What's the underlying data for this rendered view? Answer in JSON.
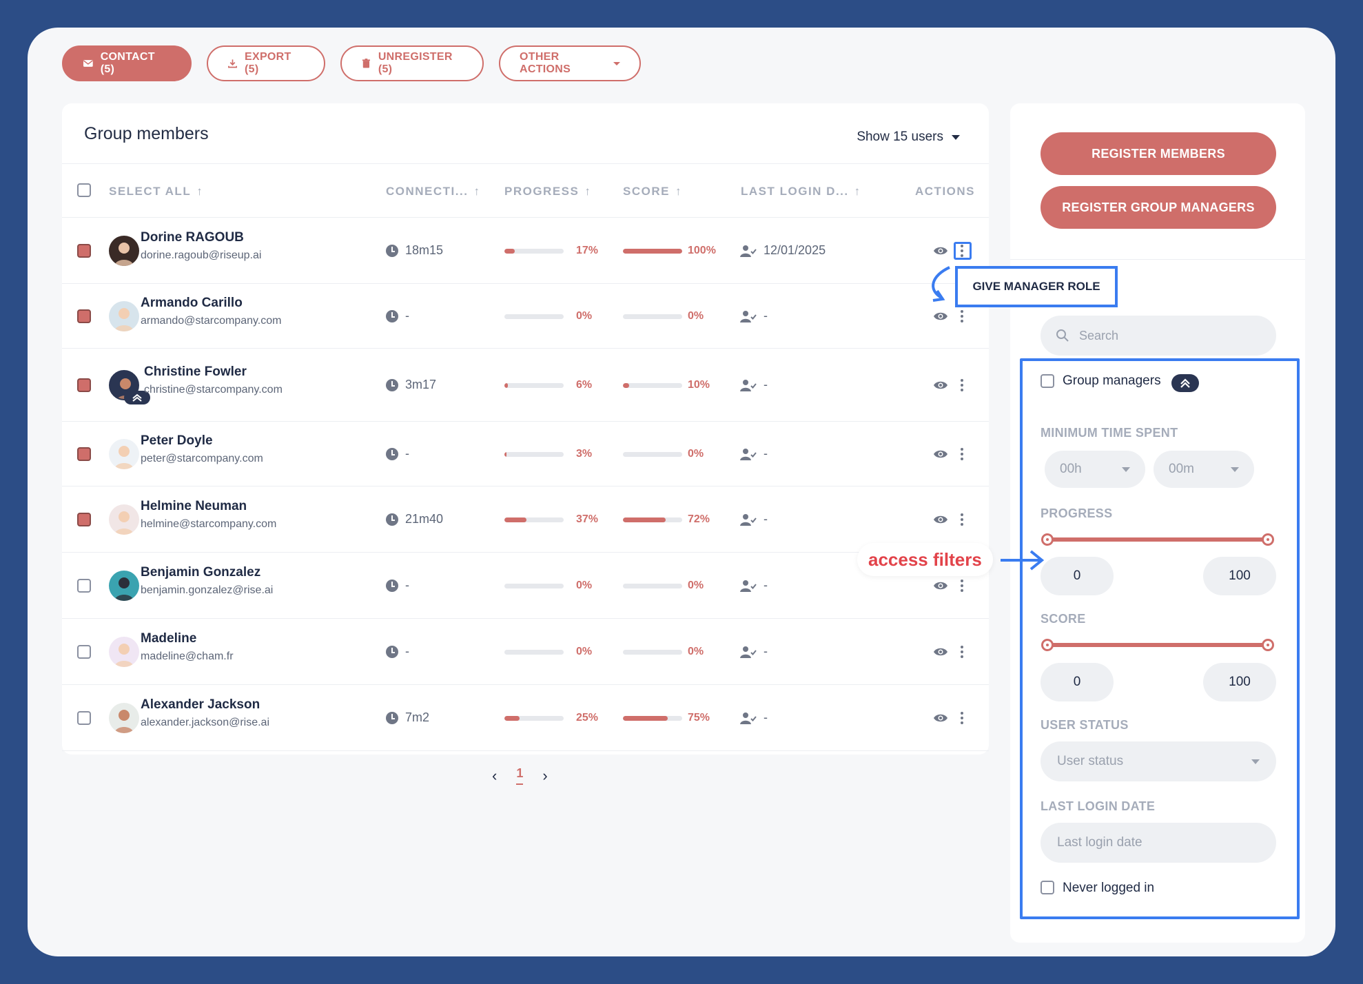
{
  "toolbar": {
    "contact_label": "CONTACT (5)",
    "export_label": "EXPORT (5)",
    "unregister_label": "UNREGISTER (5)",
    "other_actions_label": "OTHER ACTIONS"
  },
  "panel": {
    "title": "Group members",
    "show_users": "Show 15 users"
  },
  "columns": {
    "select_all": "SELECT ALL",
    "connection": "CONNECTI...",
    "progress": "PROGRESS",
    "score": "SCORE",
    "last_login": "LAST LOGIN D...",
    "actions": "ACTIONS"
  },
  "members": [
    {
      "name": "Dorine RAGOUB",
      "email": "dorine.ragoub@riseup.ai",
      "connection": "18m15",
      "progress": 17,
      "progress_label": "17%",
      "score": 100,
      "score_label": "100%",
      "last_login": "12/01/2025",
      "checked": true
    },
    {
      "name": "Armando Carillo",
      "email": "armando@starcompany.com",
      "connection": "-",
      "progress": 0,
      "progress_label": "0%",
      "score": 0,
      "score_label": "0%",
      "last_login": "-",
      "checked": true
    },
    {
      "name": "Christine Fowler",
      "email": "christine@starcompany.com",
      "connection": "3m17",
      "progress": 6,
      "progress_label": "6%",
      "score": 10,
      "score_label": "10%",
      "last_login": "-",
      "checked": true
    },
    {
      "name": "Peter Doyle",
      "email": "peter@starcompany.com",
      "connection": "-",
      "progress": 3,
      "progress_label": "3%",
      "score": 0,
      "score_label": "0%",
      "last_login": "-",
      "checked": true
    },
    {
      "name": "Helmine Neuman",
      "email": "helmine@starcompany.com",
      "connection": "21m40",
      "progress": 37,
      "progress_label": "37%",
      "score": 72,
      "score_label": "72%",
      "last_login": "-",
      "checked": true
    },
    {
      "name": "Benjamin Gonzalez",
      "email": "benjamin.gonzalez@rise.ai",
      "connection": "-",
      "progress": 0,
      "progress_label": "0%",
      "score": 0,
      "score_label": "0%",
      "last_login": "-",
      "checked": false
    },
    {
      "name": "Madeline",
      "email": "madeline@cham.fr",
      "connection": "-",
      "progress": 0,
      "progress_label": "0%",
      "score": 0,
      "score_label": "0%",
      "last_login": "-",
      "checked": false
    },
    {
      "name": "Alexander Jackson",
      "email": "alexander.jackson@rise.ai",
      "connection": "7m2",
      "progress": 25,
      "progress_label": "25%",
      "score": 75,
      "score_label": "75%",
      "last_login": "-",
      "checked": false
    }
  ],
  "pagination": {
    "current": "1"
  },
  "side": {
    "register_members": "REGISTER MEMBERS",
    "register_managers": "REGISTER GROUP MANAGERS",
    "search_placeholder": "Search",
    "group_managers": "Group managers",
    "min_time_label": "MINIMUM TIME SPENT",
    "hours": "00h",
    "minutes": "00m",
    "progress_label": "PROGRESS",
    "progress_min": "0",
    "progress_max": "100",
    "score_label": "SCORE",
    "score_min": "0",
    "score_max": "100",
    "user_status_label": "USER STATUS",
    "user_status_placeholder": "User status",
    "last_login_label": "LAST LOGIN DATE",
    "last_login_placeholder": "Last login date",
    "never_logged": "Never logged in"
  },
  "annotations": {
    "tooltip": "GIVE MANAGER ROLE",
    "access_filters": "access filters"
  },
  "colors": {
    "accent": "#cf6e6a",
    "background": "#2c4d86",
    "highlight": "#3a7cf0",
    "annotation_text": "#e2434a"
  }
}
